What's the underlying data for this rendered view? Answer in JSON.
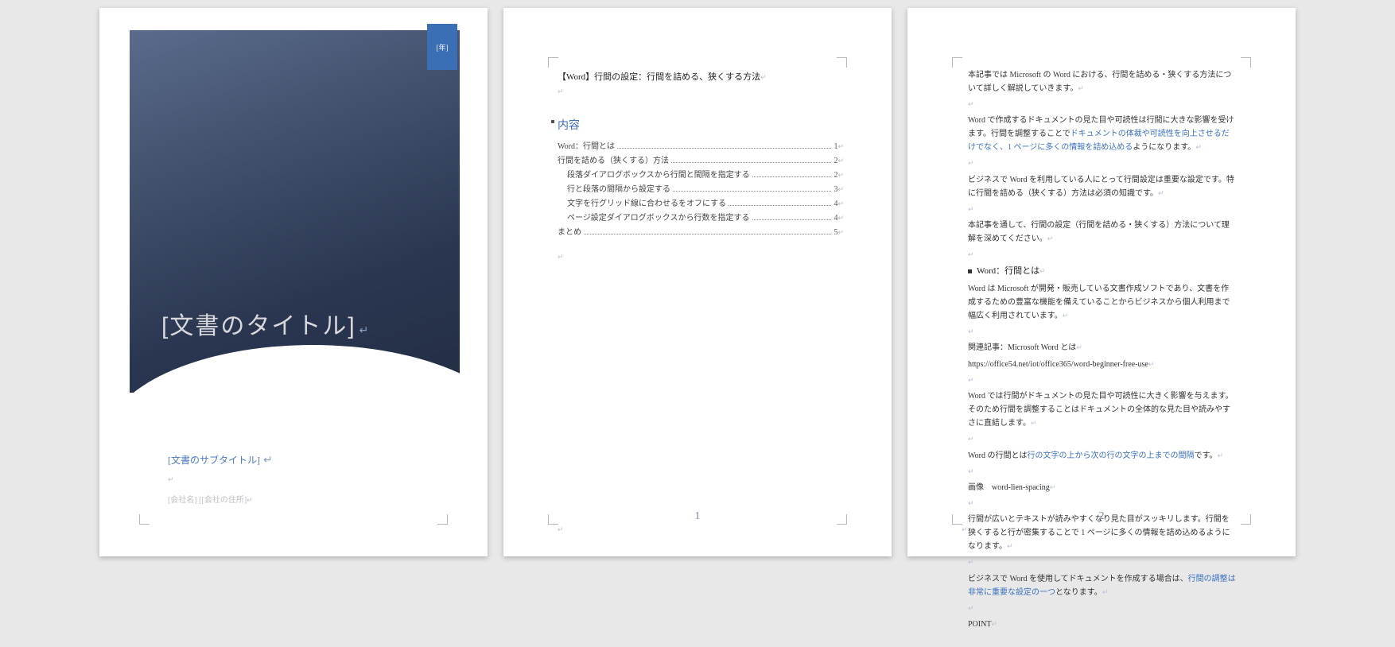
{
  "cover": {
    "year_placeholder": "[年]",
    "title": "[文書のタイトル]",
    "subtitle": "[文書のサブタイトル]",
    "company": "[会社名] [[会社の住所]"
  },
  "page2": {
    "heading": "【Word】行間の設定：行間を詰める、狭くする方法",
    "toc_title": "内容",
    "toc": [
      {
        "text": "Word：行間とは",
        "page": "1"
      },
      {
        "text": "行間を詰める（狭くする）方法",
        "page": "2"
      },
      {
        "text": "段落ダイアログボックスから行間と間隔を指定する",
        "page": "2",
        "indent": 1
      },
      {
        "text": "行と段落の間隔から設定する",
        "page": "3",
        "indent": 1
      },
      {
        "text": "文字を行グリッド線に合わせるをオフにする",
        "page": "4",
        "indent": 1
      },
      {
        "text": "ページ設定ダイアログボックスから行数を指定する",
        "page": "4",
        "indent": 1
      },
      {
        "text": "まとめ",
        "page": "5"
      }
    ]
  },
  "page3": {
    "p1a": "本記事では Microsoft の Word における、行間を詰める・狭くする方法について詳しく解説していきます。",
    "p2a": "Word で作成するドキュメントの見た目や可読性は行間に大きな影響を受けます。行間を調整することで",
    "p2b": "ドキュメントの体裁や可読性を向上させるだけでなく、1 ページに多くの情報を詰め込める",
    "p2c": "ようになります。",
    "p3": "ビジネスで Word を利用している人にとって行間設定は重要な設定です。特に行間を詰める（狭くする）方法は必須の知識です。",
    "p4": "本記事を通して、行間の設定（行間を詰める・狭くする）方法について理解を深めてください。",
    "h1": "Word：行間とは",
    "p5": "Word は Microsoft が開発・販売している文書作成ソフトであり、文書を作成するための豊富な機能を備えていることからビジネスから個人利用まで幅広く利用されています。",
    "p6a": "関連記事：Microsoft Word とは",
    "p6b": "https://office54.net/iot/office365/word-beginner-free-use",
    "p7": "Word では行間がドキュメントの見た目や可読性に大きく影響を与えます。そのため行間を調整することはドキュメントの全体的な見た目や読みやすさに直結します。",
    "p8a": "Word の行間とは",
    "p8b": "行の文字の上から次の行の文字の上までの間隔",
    "p8c": "です。",
    "p9": "画像　word-lien-spacing",
    "p10": "行間が広いとテキストが読みやすくなり見た目がスッキリします。行間を狭くすると行が密集することで 1 ページに多くの情報を詰め込めるようになります。",
    "p11a": "ビジネスで Word を使用してドキュメントを作成する場合は、",
    "p11b": "行間の調整は非常に重要な設定の一つ",
    "p11c": "となります。",
    "p12": "POINT",
    "page_num": "2"
  },
  "page2_num": "1"
}
